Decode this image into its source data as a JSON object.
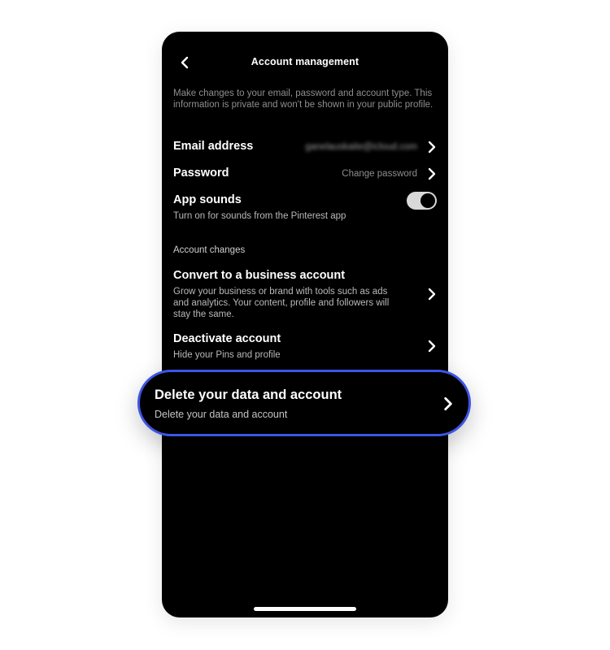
{
  "header": {
    "title": "Account management",
    "back_icon": "chevron-left-icon"
  },
  "intro": "Make changes to your email, password and account type. This information is private and won't be shown in your public profile.",
  "settings": {
    "email": {
      "label": "Email address",
      "value": "ganelauskaite@icloud.com"
    },
    "password": {
      "label": "Password",
      "value": "Change password"
    },
    "app_sounds": {
      "label": "App sounds",
      "description": "Turn on for sounds from the Pinterest app",
      "enabled": true
    }
  },
  "account_changes": {
    "section_label": "Account changes",
    "convert": {
      "label": "Convert to a business account",
      "description": "Grow your business or brand with tools such as ads and analytics. Your content, profile and followers will stay the same."
    },
    "deactivate": {
      "label": "Deactivate account",
      "description": "Hide your Pins and profile"
    },
    "delete": {
      "label": "Delete your data and account",
      "description": "Delete your data and account"
    }
  },
  "colors": {
    "background": "#000000",
    "text_primary": "#ffffff",
    "text_secondary": "#8e8e8e",
    "highlight_border": "#3e55e6",
    "toggle_track": "#d9d9d9"
  },
  "icons": {
    "row_chevron": "chevron-right-icon"
  }
}
